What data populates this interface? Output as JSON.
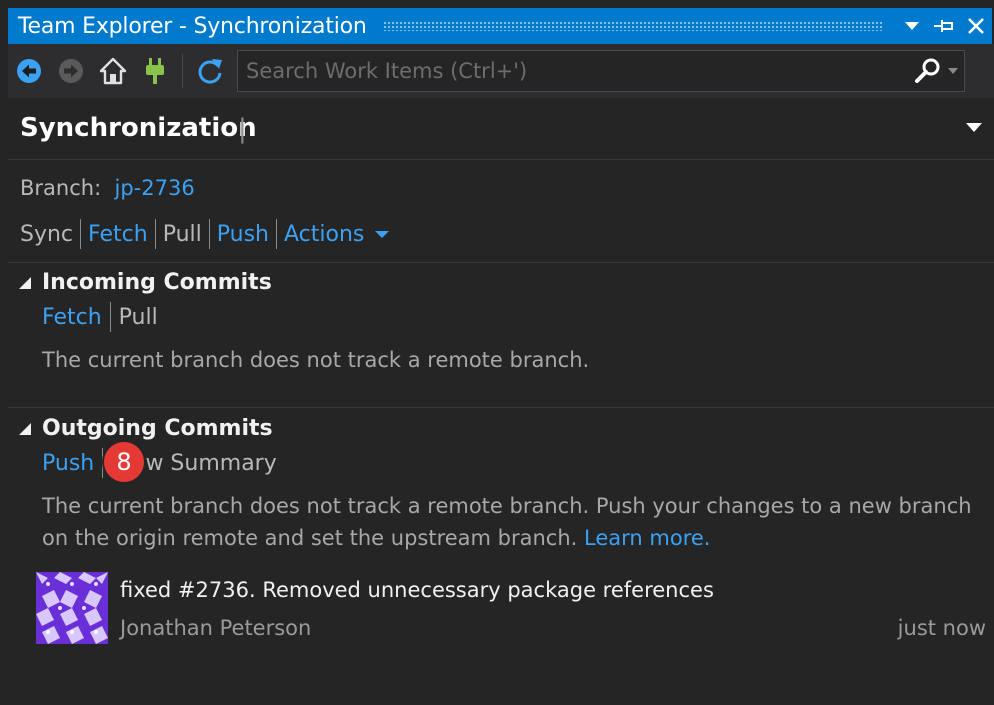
{
  "window": {
    "title": "Team Explorer - Synchronization"
  },
  "toolbar": {
    "search_placeholder": "Search Work Items (Ctrl+')"
  },
  "page": {
    "title": "Synchronization",
    "title_caret": "|"
  },
  "branch": {
    "label": "Branch:",
    "name": "jp-2736"
  },
  "actions": {
    "sync": "Sync",
    "fetch": "Fetch",
    "pull": "Pull",
    "push": "Push",
    "actions": "Actions"
  },
  "incoming": {
    "title": "Incoming Commits",
    "fetch": "Fetch",
    "pull": "Pull",
    "message": "The current branch does not track a remote branch."
  },
  "outgoing": {
    "title": "Outgoing Commits",
    "push": "Push",
    "view_summary": "View Summary",
    "badge": "8",
    "message": "The current branch does not track a remote branch. Push your changes to a new branch on the origin remote and set the upstream branch.",
    "learn_more": "Learn more."
  },
  "commits": [
    {
      "message": "fixed #2736. Removed unnecessary package references",
      "author": "Jonathan Peterson",
      "time": "just now"
    }
  ],
  "colors": {
    "accent": "#007acc",
    "link": "#3ba1f3",
    "badge": "#e53935",
    "background": "#252526"
  }
}
